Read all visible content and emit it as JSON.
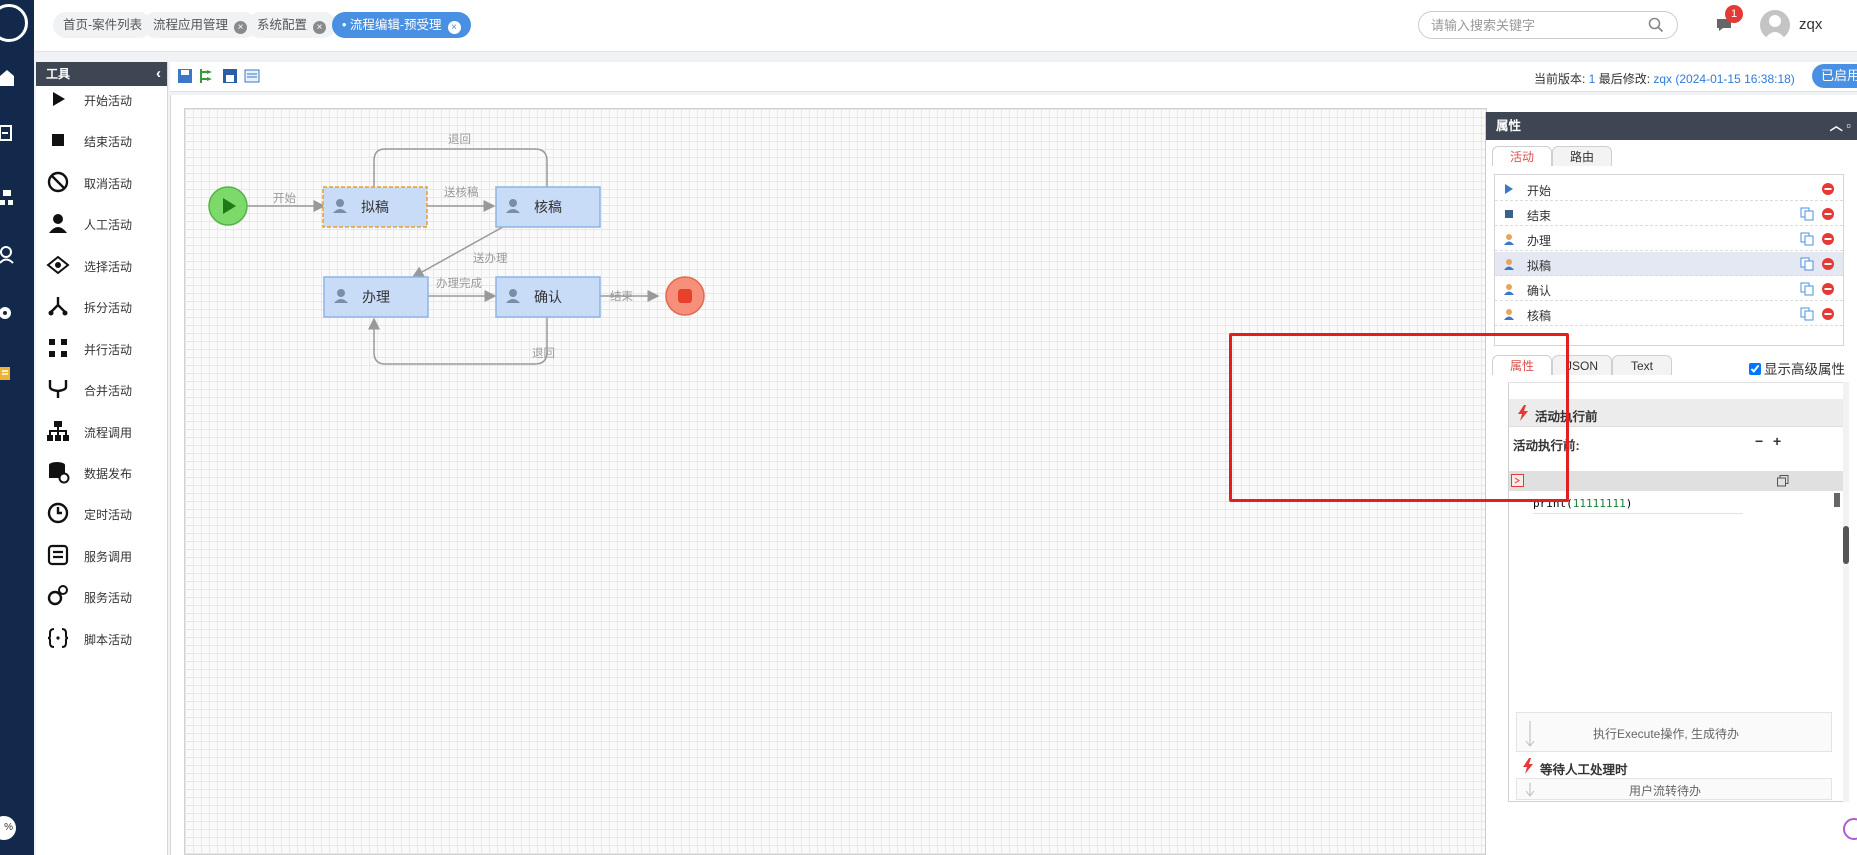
{
  "nav": {
    "icons": [
      "logo-icon",
      "home-icon",
      "import-icon",
      "org-icon",
      "user-icon",
      "settings-icon",
      "note-icon"
    ],
    "zoom_badge": "%"
  },
  "tabs": [
    {
      "label": "首页-案件列表",
      "closable": false,
      "active": false
    },
    {
      "label": "流程应用管理",
      "closable": true,
      "active": false
    },
    {
      "label": "系统配置",
      "closable": true,
      "active": false
    },
    {
      "label": "流程编辑-预受理",
      "closable": true,
      "active": true
    }
  ],
  "search": {
    "placeholder": "请输入搜索关键字"
  },
  "notifications": {
    "count": "1"
  },
  "user": {
    "name": "zqx"
  },
  "tools": {
    "title": "工具",
    "items": [
      {
        "label": "开始活动",
        "icon": "play-icon"
      },
      {
        "label": "结束活动",
        "icon": "stop-icon"
      },
      {
        "label": "取消活动",
        "icon": "cancel-icon"
      },
      {
        "label": "人工活动",
        "icon": "person-icon"
      },
      {
        "label": "选择活动",
        "icon": "choice-icon"
      },
      {
        "label": "拆分活动",
        "icon": "split-icon"
      },
      {
        "label": "并行活动",
        "icon": "parallel-icon"
      },
      {
        "label": "合并活动",
        "icon": "merge-icon"
      },
      {
        "label": "流程调用",
        "icon": "subflow-icon"
      },
      {
        "label": "数据发布",
        "icon": "database-icon"
      },
      {
        "label": "定时活动",
        "icon": "clock-icon"
      },
      {
        "label": "服务调用",
        "icon": "service-icon"
      },
      {
        "label": "服务活动",
        "icon": "gears-icon"
      },
      {
        "label": "脚本活动",
        "icon": "script-icon"
      }
    ]
  },
  "version": {
    "prefix": "当前版本: ",
    "number": "1",
    "modified_prefix": " 最后修改: ",
    "modified_value": "zqx (2024-01-15 16:38:18)",
    "status_button": "已启用"
  },
  "flow": {
    "nodes": {
      "draft": "拟稿",
      "review": "核稿",
      "handle": "办理",
      "confirm": "确认"
    },
    "edges": {
      "start": "开始",
      "back_top": "退回",
      "send_review": "送核稿",
      "send_handle": "送办理",
      "handle_done": "办理完成",
      "end": "结束",
      "back_bottom": "退回"
    }
  },
  "props": {
    "title": "属性",
    "top_tabs": [
      "活动",
      "路由"
    ],
    "activities": [
      {
        "label": "开始",
        "icon": "start-triangle-icon",
        "copy": false
      },
      {
        "label": "结束",
        "icon": "end-square-icon",
        "copy": true
      },
      {
        "label": "办理",
        "icon": "person-icon",
        "copy": true
      },
      {
        "label": "拟稿",
        "icon": "person-icon",
        "copy": true,
        "selected": true
      },
      {
        "label": "确认",
        "icon": "person-icon",
        "copy": true
      },
      {
        "label": "核稿",
        "icon": "person-icon",
        "copy": true
      }
    ],
    "bottom_tabs": [
      "属性",
      "JSON",
      "Text"
    ],
    "advanced_label": "显示高级属性",
    "advanced_checked": true,
    "section_title": "活动执行前",
    "field_label": "活动执行前:",
    "minus": "−",
    "plus": "+",
    "code": {
      "fn": "print",
      "arg": "11111111"
    },
    "execute_text": "执行Execute操作, 生成待办",
    "wait_title": "等待人工处理时",
    "transfer_text": "用户流转待办"
  },
  "colors": {
    "nav_bg": "#13294b",
    "accent": "#4a90e2",
    "node_fill": "#c9dcf7",
    "node_stroke": "#8eb4e3",
    "start_fill": "#7ed96b",
    "end_fill": "#f6907a",
    "highlight": "#e02020"
  }
}
